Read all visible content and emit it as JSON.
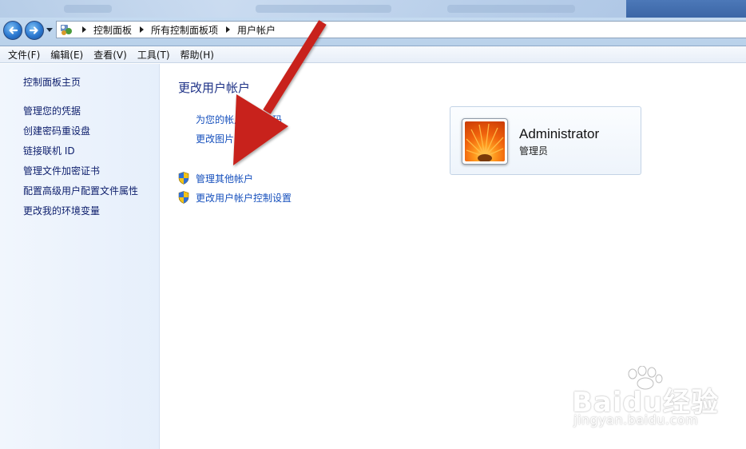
{
  "address_bar": {
    "breadcrumbs": [
      "控制面板",
      "所有控制面板项",
      "用户帐户"
    ]
  },
  "menu": {
    "items": [
      "文件(F)",
      "编辑(E)",
      "查看(V)",
      "工具(T)",
      "帮助(H)"
    ]
  },
  "sidebar": {
    "home": "控制面板主页",
    "items": [
      "管理您的凭据",
      "创建密码重设盘",
      "链接联机 ID",
      "管理文件加密证书",
      "配置高级用户配置文件属性",
      "更改我的环境变量"
    ]
  },
  "main": {
    "title": "更改用户帐户",
    "links": {
      "create_password_partial": "为您的帐户",
      "create_password_tail": "码",
      "change_picture": "更改图片",
      "manage_other_accounts": "管理其他帐户",
      "uac_settings": "更改用户帐户控制设置"
    }
  },
  "user": {
    "name": "Administrator",
    "role": "管理员"
  },
  "watermark": {
    "brand": "Baidu经验",
    "url": "jingyan.baidu.com"
  },
  "icons": {
    "back": "back-arrow-icon",
    "forward": "forward-arrow-icon",
    "control_panel": "control-panel-icon",
    "shield": "uac-shield-icon"
  },
  "colors": {
    "link": "#1650bd",
    "title": "#1e3287",
    "sidebar_link": "#0d1e6c",
    "annotation_arrow": "#c8241a"
  }
}
